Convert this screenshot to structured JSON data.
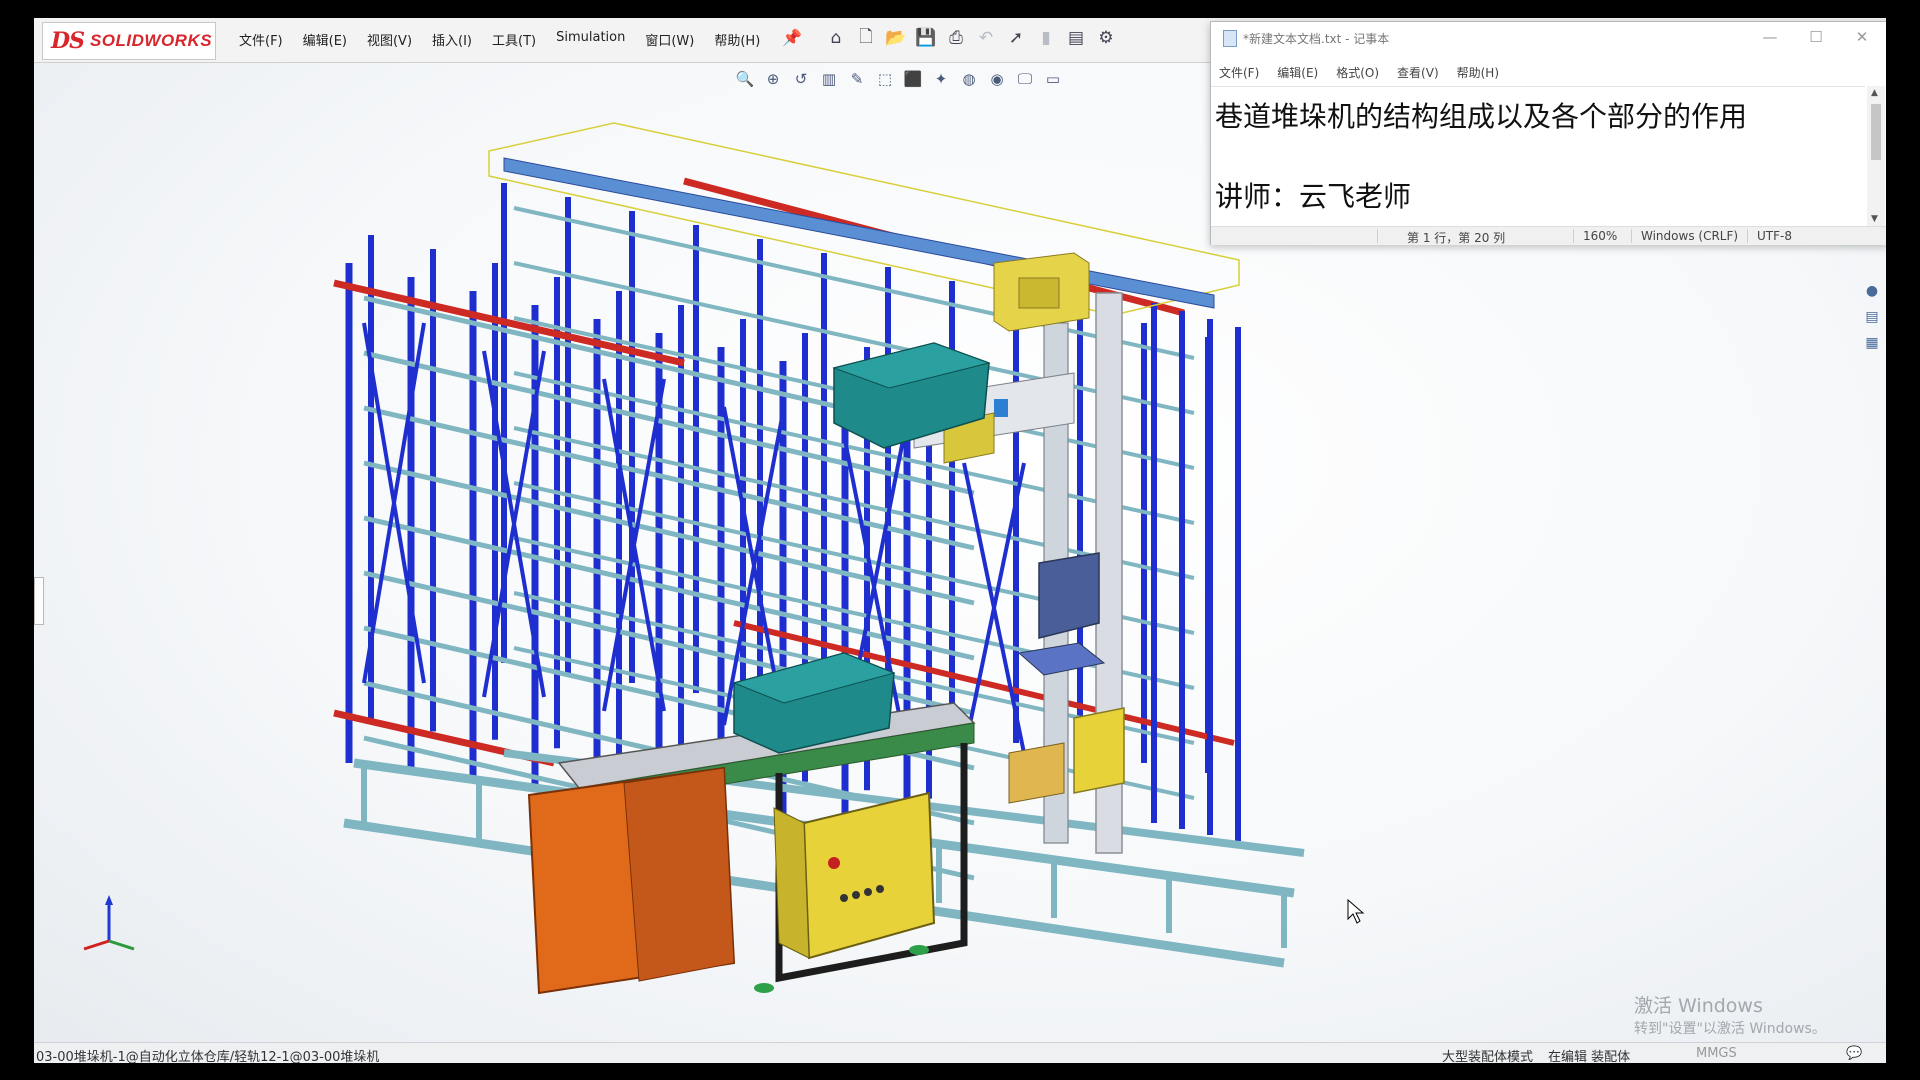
{
  "app": {
    "logo_mark": "DS",
    "logo_name": "SOLIDWORKS",
    "menu": [
      "文件(F)",
      "编辑(E)",
      "视图(V)",
      "插入(I)",
      "工具(T)",
      "Simulation",
      "窗口(W)",
      "帮助(H)"
    ],
    "toolbar_top": [
      "home-icon",
      "new-document-icon",
      "open-folder-icon",
      "save-icon",
      "print-icon",
      "undo-icon",
      "select-arrow-icon",
      "rebuild-icon",
      "file-properties-icon",
      "options-gear-icon"
    ],
    "toolbar_view": [
      "zoom-to-fit-icon",
      "zoom-area-icon",
      "previous-view-icon",
      "section-view-icon",
      "dynamic-annotation-icon",
      "view-orientation-icon",
      "display-style-icon",
      "hide-show-icon",
      "edit-appearance-icon",
      "apply-scene-icon",
      "view-settings-icon",
      "display-pane-icon"
    ]
  },
  "notepad": {
    "title": "*新建文本文档.txt - 记事本",
    "menu": [
      "文件(F)",
      "编辑(E)",
      "格式(O)",
      "查看(V)",
      "帮助(H)"
    ],
    "lines": [
      "巷道堆垛机的结构组成以及各个部分的作用",
      "",
      "讲师：云飞老师"
    ],
    "status": {
      "position": "第 1 行，第 20 列",
      "zoom": "160%",
      "line_ending": "Windows (CRLF)",
      "encoding": "UTF-8"
    }
  },
  "watermark": {
    "line1": "激活 Windows",
    "line2": "转到\"设置\"以激活 Windows。"
  },
  "statusbar": {
    "path": "03-00堆垛机-1@自动化立体仓库/轻轨12-1@03-00堆垛机",
    "mode1": "大型装配体模式",
    "mode2": "在编辑 装配体",
    "units": "MMGS"
  },
  "colors": {
    "rack_blue": "#1f2fcf",
    "beam_red": "#cc2a22",
    "frame_teal": "#7fb6c2",
    "cabinet_orange": "#e06a1a",
    "box_yellow": "#e8d23a",
    "tote_teal": "#1e8a8a"
  }
}
